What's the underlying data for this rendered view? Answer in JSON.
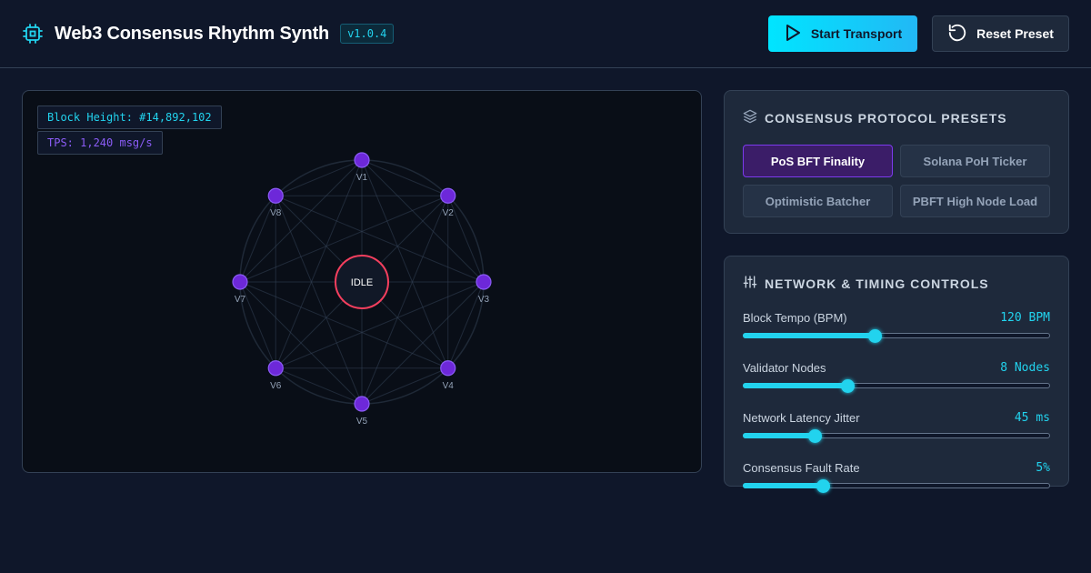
{
  "header": {
    "title": "Web3 Consensus Rhythm Synth",
    "version": "v1.0.4",
    "start_label": "Start Transport",
    "reset_label": "Reset Preset",
    "icons": {
      "logo": "cpu-chip-icon",
      "start": "play-icon",
      "reset": "rotate-ccw-icon"
    }
  },
  "visualizer": {
    "block_height": "Block Height: #14,892,102",
    "tps": "TPS: 1,240 msg/s",
    "center_status": "IDLE",
    "validators": [
      "V1",
      "V2",
      "V3",
      "V4",
      "V5",
      "V6",
      "V7",
      "V8"
    ]
  },
  "presets": {
    "title": "Consensus Protocol Presets",
    "icon": "layers-icon",
    "items": [
      {
        "label": "PoS BFT Finality",
        "active": true
      },
      {
        "label": "Solana PoH Ticker",
        "active": false
      },
      {
        "label": "Optimistic Batcher",
        "active": false
      },
      {
        "label": "PBFT High Node Load",
        "active": false
      }
    ]
  },
  "controls": {
    "title": "Network & Timing Controls",
    "icon": "sliders-icon",
    "items": [
      {
        "label": "Block Tempo (BPM)",
        "value": "120 BPM",
        "fraction": 0.43
      },
      {
        "label": "Validator Nodes",
        "value": "8 Nodes",
        "fraction": 0.34
      },
      {
        "label": "Network Latency Jitter",
        "value": "45 ms",
        "fraction": 0.235
      },
      {
        "label": "Consensus Fault Rate",
        "value": "5%",
        "fraction": 0.26
      }
    ]
  },
  "colors": {
    "accent": "#22d3ee",
    "validator": "#6d28d9",
    "status_ring": "#f43f5e",
    "active_preset": "#7c3aed"
  }
}
